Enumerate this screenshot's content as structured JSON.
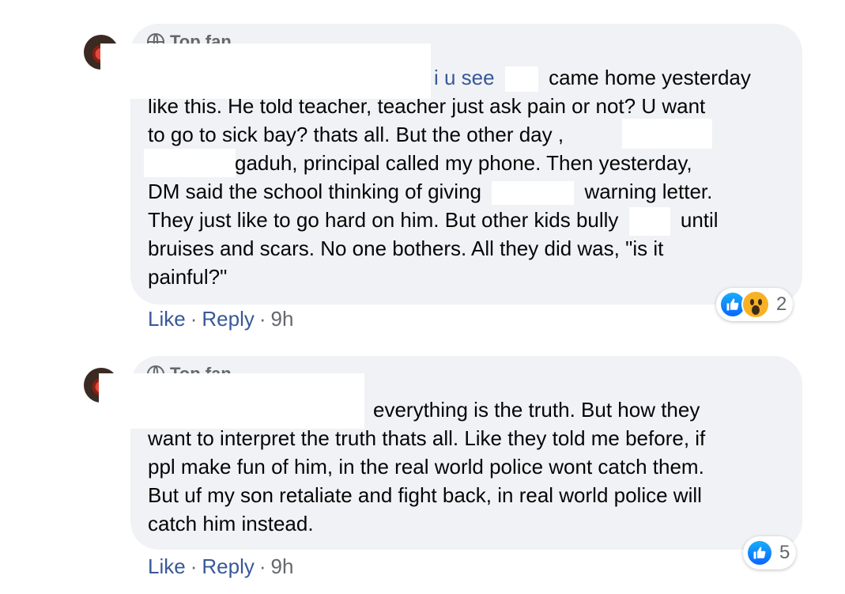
{
  "comments": [
    {
      "badge": "Top fan",
      "lines": [
        "i u see",
        "came home yesterday",
        "like this. He told teacher, teacher just ask pain or not? U want",
        "to go to sick bay? thats all. But the other day ,",
        "gaduh, principal called my phone. Then yesterday,",
        "DM said the school thinking of giving",
        "warning letter.",
        "They just like to go hard on him. But other kids bully",
        "until",
        "bruises and scars. No one bothers. All they did was, \"is it",
        "painful?\""
      ],
      "actions": {
        "like": "Like",
        "reply": "Reply",
        "time": "9h",
        "sep": "·"
      },
      "reactions": {
        "types": [
          "like-icon",
          "wow-icon"
        ],
        "count": "2"
      }
    },
    {
      "badge": "Top fan",
      "lines": [
        "everything is the truth. But how they",
        "want to interpret the truth thats all. Like they told me before, if",
        "ppl make fun of him, in the real world police wont catch them.",
        "But uf my son retaliate and fight back, in real world police will",
        "catch him instead."
      ],
      "actions": {
        "like": "Like",
        "reply": "Reply",
        "time": "9h",
        "sep": "·"
      },
      "reactions": {
        "types": [
          "like-icon"
        ],
        "count": "5"
      }
    }
  ],
  "colors": {
    "bubble": "#f0f2f5",
    "link": "#385898",
    "meta": "#65676b",
    "like": "#0866ff",
    "wow": "#f7b125"
  }
}
